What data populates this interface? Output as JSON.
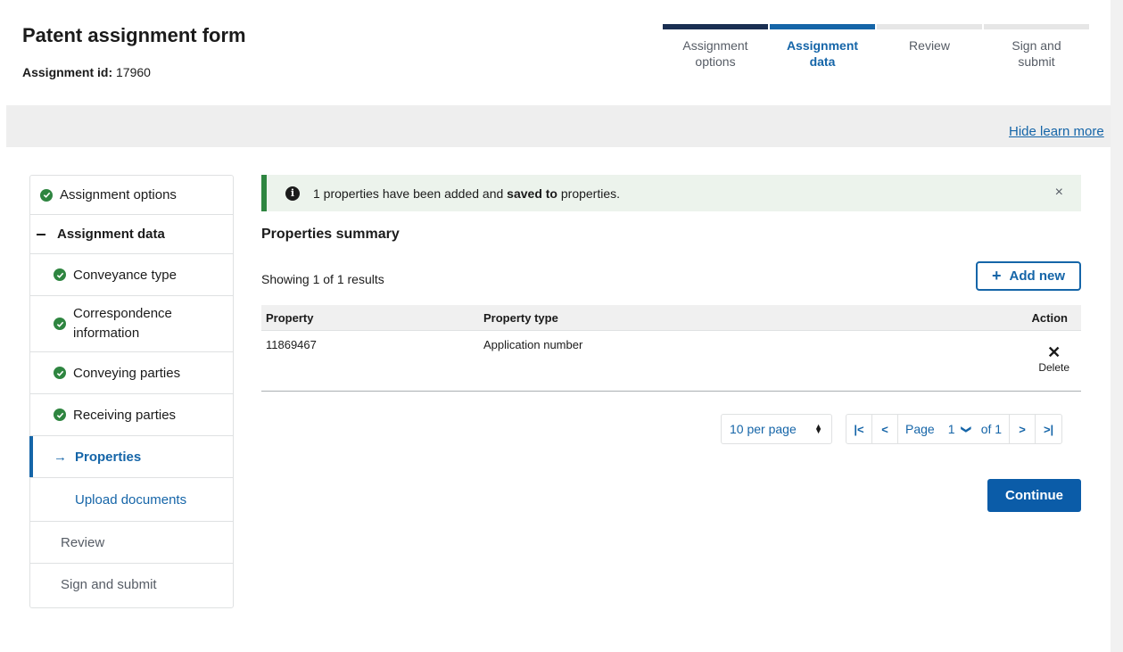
{
  "header": {
    "title": "Patent assignment form",
    "assignment_id_label": "Assignment id:",
    "assignment_id_value": "17960"
  },
  "steps": [
    {
      "line1": "Assignment",
      "line2": "options",
      "state": "done"
    },
    {
      "line1": "Assignment",
      "line2": "data",
      "state": "current"
    },
    {
      "line1": "Review",
      "line2": "",
      "state": "upcoming"
    },
    {
      "line1": "Sign and",
      "line2": "submit",
      "state": "upcoming"
    }
  ],
  "learn_more": {
    "label": "Hide learn more"
  },
  "sidebar": {
    "items": [
      {
        "label": "Assignment options"
      },
      {
        "label": "Assignment data"
      },
      {
        "label": "Conveyance type"
      },
      {
        "line1": "Correspondence",
        "line2": "information"
      },
      {
        "label": "Conveying parties"
      },
      {
        "label": "Receiving parties"
      },
      {
        "label": "Properties"
      },
      {
        "label": "Upload documents"
      },
      {
        "label": "Review"
      },
      {
        "label": "Sign and submit"
      }
    ]
  },
  "alert": {
    "part1": "1 properties have been added and ",
    "part_bold": "saved to",
    "part2": " properties.",
    "close": "×"
  },
  "properties": {
    "title": "Properties summary",
    "showing": "Showing 1 of 1 results",
    "add_new_label": "Add new",
    "columns": {
      "property": "Property",
      "property_type": "Property type",
      "action": "Action"
    },
    "rows": [
      {
        "property": "11869467",
        "property_type": "Application number",
        "action": "Delete"
      }
    ]
  },
  "pagination": {
    "per_page": "10 per page",
    "page_label": "Page",
    "current_page": "1",
    "of_label": "of 1",
    "first": "|<",
    "prev": "<",
    "next": ">",
    "last": ">|"
  },
  "continue_label": "Continue",
  "colors": {
    "primary": "#1565a8",
    "navy": "#1a2f52",
    "success": "#2e8540",
    "alert_bg": "#ecf3ec"
  }
}
